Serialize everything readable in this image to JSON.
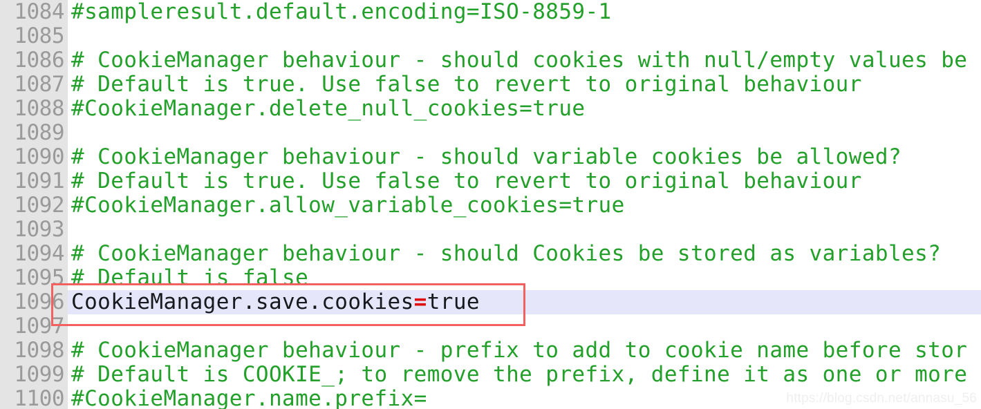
{
  "editor": {
    "gutter_bg": "#e4e4e4",
    "content_bg": "#ffffff",
    "comment_color": "#23a02a",
    "active_text_color": "#18181f",
    "highlight_bg": "#e6e6fa",
    "annotation_color": "#f26060",
    "equals_color": "#e01010",
    "line_number_color": "#9a9a9a"
  },
  "lines": [
    {
      "number": "1084",
      "text": "#sampleresult.default.encoding=ISO-8859-1",
      "kind": "comment",
      "highlighted": false
    },
    {
      "number": "1085",
      "text": "",
      "kind": "comment",
      "highlighted": false
    },
    {
      "number": "1086",
      "text": "# CookieManager behaviour - should cookies with null/empty values be",
      "kind": "comment",
      "highlighted": false
    },
    {
      "number": "1087",
      "text": "# Default is true. Use false to revert to original behaviour",
      "kind": "comment",
      "highlighted": false
    },
    {
      "number": "1088",
      "text": "#CookieManager.delete_null_cookies=true",
      "kind": "comment",
      "highlighted": false
    },
    {
      "number": "1089",
      "text": "",
      "kind": "comment",
      "highlighted": false
    },
    {
      "number": "1090",
      "text": "# CookieManager behaviour - should variable cookies be allowed?",
      "kind": "comment",
      "highlighted": false
    },
    {
      "number": "1091",
      "text": "# Default is true. Use false to revert to original behaviour",
      "kind": "comment",
      "highlighted": false
    },
    {
      "number": "1092",
      "text": "#CookieManager.allow_variable_cookies=true",
      "kind": "comment",
      "highlighted": false
    },
    {
      "number": "1093",
      "text": "",
      "kind": "comment",
      "highlighted": false
    },
    {
      "number": "1094",
      "text": "# CookieManager behaviour - should Cookies be stored as variables?",
      "kind": "comment",
      "highlighted": false
    },
    {
      "number": "1095",
      "text": "# Default is false",
      "kind": "comment",
      "highlighted": false
    },
    {
      "number": "1096",
      "text": "CookieManager.save.cookies",
      "text_after_equals": "true",
      "equals": "=",
      "kind": "active",
      "highlighted": true
    },
    {
      "number": "1097",
      "text": "",
      "kind": "comment",
      "highlighted": false
    },
    {
      "number": "1098",
      "text": "# CookieManager behaviour - prefix to add to cookie name before stor",
      "kind": "comment",
      "highlighted": false
    },
    {
      "number": "1099",
      "text": "# Default is COOKIE_; to remove the prefix, define it as one or more",
      "kind": "comment",
      "highlighted": false
    },
    {
      "number": "1100",
      "text": "#CookieManager.name.prefix=",
      "kind": "comment",
      "highlighted": false
    }
  ],
  "watermark": {
    "text": "https://blog.csdn.net/annasu_56"
  }
}
